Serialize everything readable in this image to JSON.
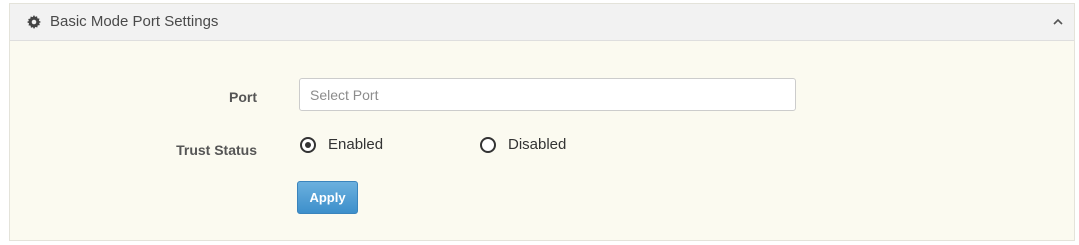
{
  "panel": {
    "title": "Basic Mode Port Settings",
    "icon": "gear-icon",
    "collapse_icon": "chevron-up-icon"
  },
  "form": {
    "port": {
      "label": "Port",
      "value": "",
      "placeholder": "Select Port"
    },
    "trust_status": {
      "label": "Trust Status",
      "options": [
        {
          "label": "Enabled",
          "checked": true
        },
        {
          "label": "Disabled",
          "checked": false
        }
      ]
    },
    "apply_label": "Apply"
  },
  "colors": {
    "panel_background": "#fbfaf0",
    "header_background": "#f2f2f2",
    "button_primary": "#4a9ad4"
  }
}
